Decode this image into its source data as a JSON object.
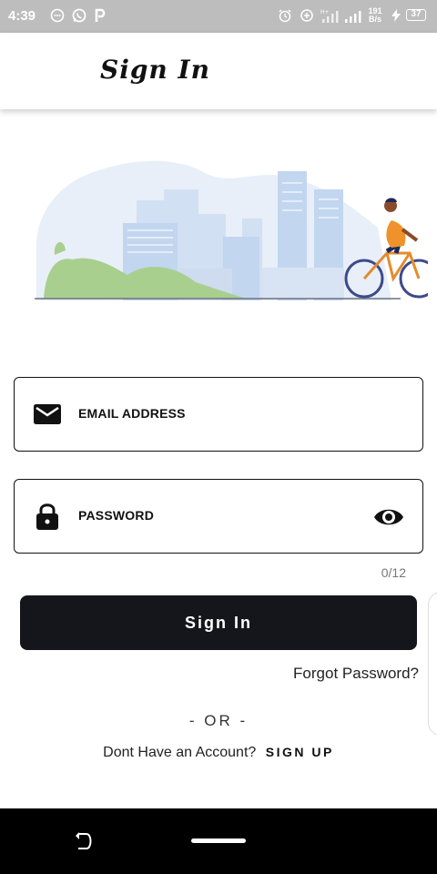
{
  "status_bar": {
    "time": "4:39",
    "net_speed_top": "191",
    "net_speed_bottom": "B/s",
    "battery": "37"
  },
  "app_bar": {
    "title": "Sign In"
  },
  "form": {
    "email_label": "EMAIL ADDRESS",
    "password_label": "PASSWORD",
    "password_counter": "0/12",
    "submit_label": "Sign In",
    "forgot_label": "Forgot Password?",
    "divider": "- OR -",
    "signup_prompt": "Dont Have an Account?",
    "signup_link": "SIGN UP"
  },
  "icons": {
    "email": "mail-icon",
    "password": "lock-icon",
    "visibility": "eye-icon"
  },
  "colors": {
    "primary_button": "#14161c",
    "status_bar": "#bdbdbd",
    "hint_text": "#777777"
  }
}
